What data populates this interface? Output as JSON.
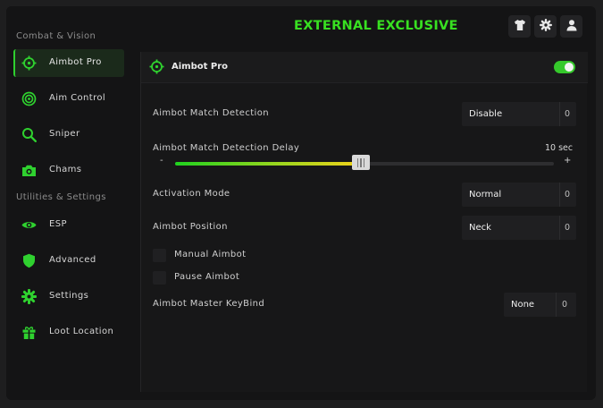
{
  "header": {
    "title": "EXTERNAL EXCLUSIVE"
  },
  "colors": {
    "accent": "#2fd12f",
    "title_green": "#38e021",
    "toggle_on": "#35c82b",
    "slider_start": "#1fd21f",
    "slider_end": "#f2d21a"
  },
  "header_buttons": [
    {
      "icon": "shirt-icon"
    },
    {
      "icon": "gear-icon"
    },
    {
      "icon": "user-icon"
    }
  ],
  "sidebar": {
    "sections": [
      {
        "title": "Combat & Vision"
      },
      {
        "title": "Utilities & Settings"
      }
    ],
    "items": [
      {
        "label": "Aimbot Pro",
        "icon": "crosshair-icon",
        "active": true
      },
      {
        "label": "Aim Control",
        "icon": "target-icon",
        "active": false
      },
      {
        "label": "Sniper",
        "icon": "magnifier-icon",
        "active": false
      },
      {
        "label": "Chams",
        "icon": "camera-icon",
        "active": false
      },
      {
        "label": "ESP",
        "icon": "eye-icon",
        "active": false
      },
      {
        "label": "Advanced",
        "icon": "shield-icon",
        "active": false
      },
      {
        "label": "Settings",
        "icon": "gear-icon",
        "active": false
      },
      {
        "label": "Loot Location",
        "icon": "gift-icon",
        "active": false
      }
    ]
  },
  "panel": {
    "title": "Aimbot Pro",
    "enabled": true,
    "match_detection": {
      "label": "Aimbot Match Detection",
      "value": "Disable",
      "key": "0"
    },
    "detection_delay": {
      "label": "Aimbot Match Detection Delay",
      "value_text": "10 sec",
      "minus": "-",
      "plus": "+",
      "fraction": 0.49
    },
    "activation_mode": {
      "label": "Activation Mode",
      "value": "Normal",
      "key": "0"
    },
    "aimbot_position": {
      "label": "Aimbot Position",
      "value": "Neck",
      "key": "0"
    },
    "manual_aimbot": {
      "label": "Manual Aimbot",
      "checked": false
    },
    "pause_aimbot": {
      "label": "Pause Aimbot",
      "checked": false
    },
    "master_keybind": {
      "label": "Aimbot Master KeyBind",
      "value": "None",
      "key": "0"
    }
  }
}
